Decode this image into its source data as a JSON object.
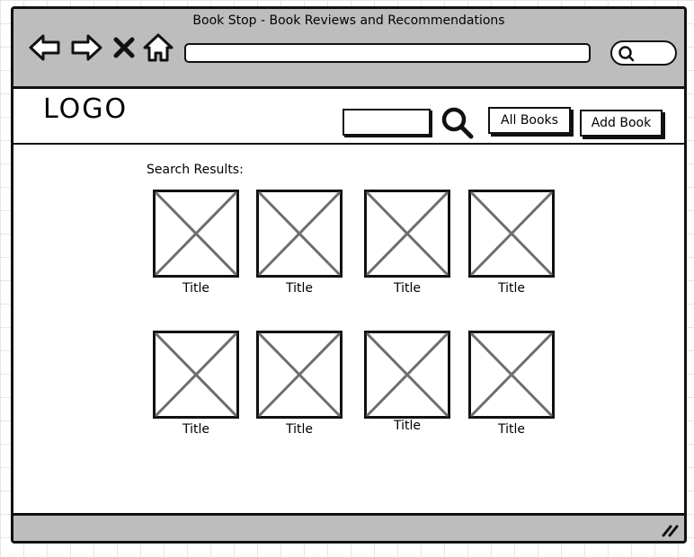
{
  "window": {
    "title": "Book Stop - Book Reviews and Recommendations"
  },
  "browser": {
    "back_icon": "arrow-left-icon",
    "forward_icon": "arrow-right-icon",
    "stop_icon": "close-icon",
    "home_icon": "home-icon",
    "address_value": "",
    "search_icon": "search-icon"
  },
  "header": {
    "logo": "LOGO",
    "search_value": "",
    "search_icon": "search-icon",
    "all_books_label": "All Books",
    "add_book_label": "Add Book"
  },
  "results": {
    "label": "Search Results:",
    "items": [
      {
        "title": "Title",
        "image_icon": "image-placeholder-icon"
      },
      {
        "title": "Title",
        "image_icon": "image-placeholder-icon"
      },
      {
        "title": "Title",
        "image_icon": "image-placeholder-icon"
      },
      {
        "title": "Title",
        "image_icon": "image-placeholder-icon"
      },
      {
        "title": "Title",
        "image_icon": "image-placeholder-icon"
      },
      {
        "title": "Title",
        "image_icon": "image-placeholder-icon"
      },
      {
        "title": "Title",
        "image_icon": "image-placeholder-icon"
      },
      {
        "title": "Title",
        "image_icon": "image-placeholder-icon"
      }
    ]
  },
  "colors": {
    "chrome_gray": "#bdbdbd",
    "stroke": "#111111",
    "placeholder_cross": "#6e6e6e"
  }
}
